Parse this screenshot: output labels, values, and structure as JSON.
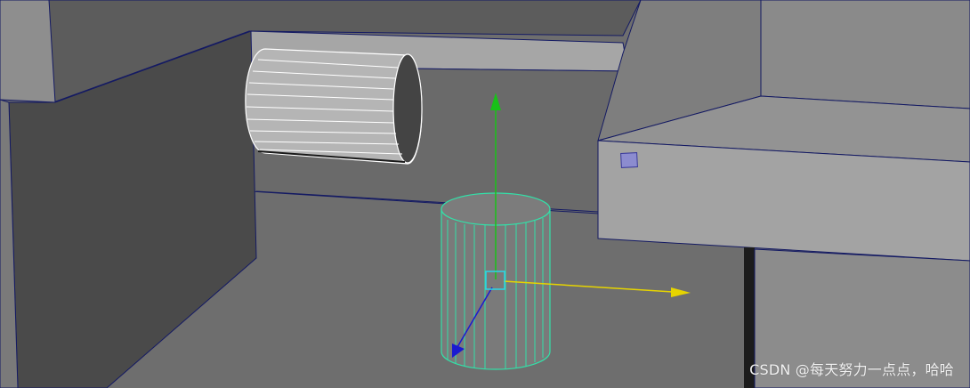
{
  "watermark": {
    "text": "CSDN @每天努力一点点，哈哈"
  },
  "colors": {
    "edge": "#141a63",
    "selection_wire": "#33e0a8",
    "axis_y": "#19c119",
    "axis_x": "#e6d400",
    "axis_z": "#1a1ad1",
    "pivot": "#2ad6e8",
    "corner_handle": "#8c8ccf"
  },
  "icons": {
    "move_manipulator": "move-tool-icon",
    "pivot": "pivot-icon",
    "component_handle": "handle-icon"
  }
}
